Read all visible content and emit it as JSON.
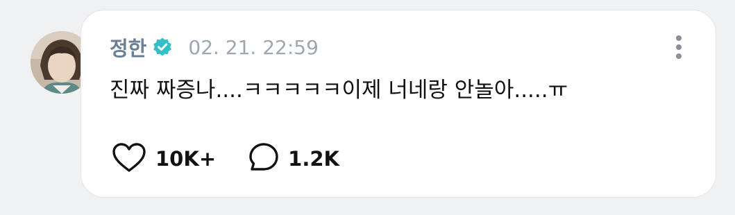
{
  "post": {
    "author": {
      "name": "정한",
      "verified": true,
      "avatar_icon": "profile-photo"
    },
    "timestamp": "02. 21. 22:59",
    "message": "진짜 짜증나....ㅋㅋㅋㅋㅋ이제 너네랑 안놀아.....ㅠ",
    "actions": {
      "like": {
        "icon": "heart-outline-icon",
        "count": "10K+"
      },
      "comment": {
        "icon": "speech-bubble-icon",
        "count": "1.2K"
      }
    },
    "more_icon": "vertical-ellipsis-icon"
  },
  "colors": {
    "background": "#f0f1f3",
    "card": "#ffffff",
    "author_name": "#6b7f95",
    "verified_badge": "#2fc1c7",
    "timestamp": "#9ea6b0",
    "text": "#111111"
  }
}
